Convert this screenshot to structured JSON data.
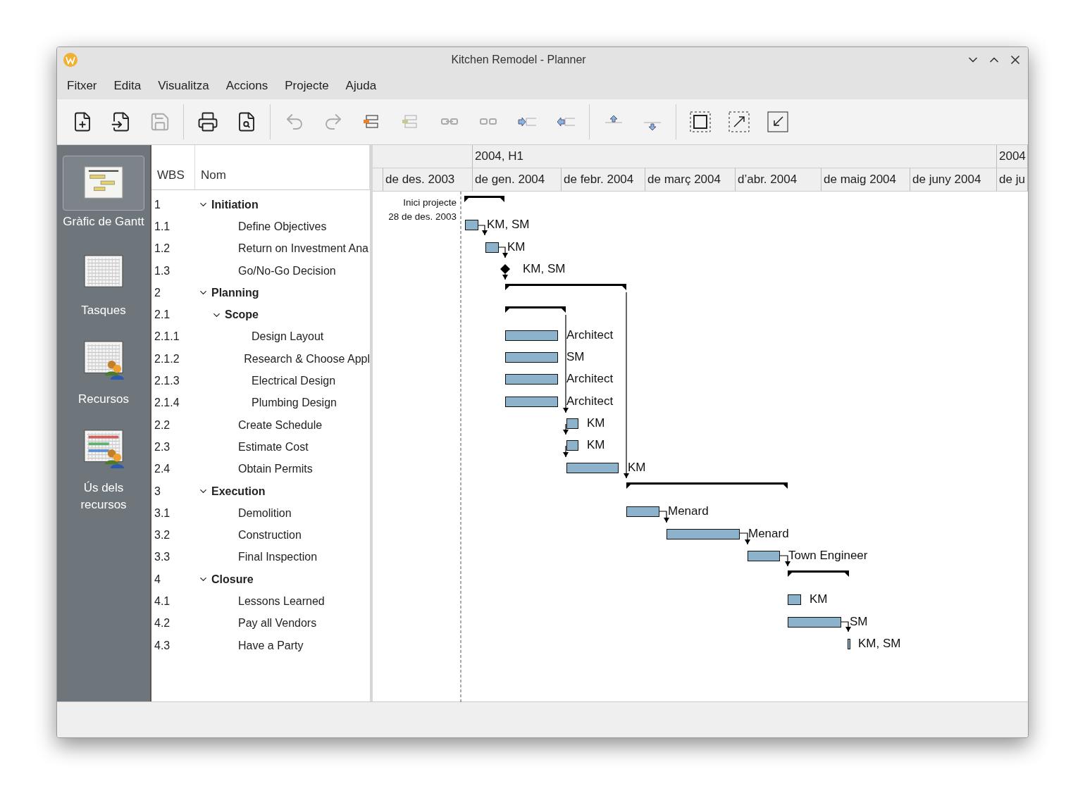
{
  "window": {
    "title": "Kitchen Remodel - Planner"
  },
  "menu": [
    "Fitxer",
    "Edita",
    "Visualitza",
    "Accions",
    "Projecte",
    "Ajuda"
  ],
  "toolbar": [
    {
      "kind": "new",
      "disabled": false
    },
    {
      "kind": "open",
      "disabled": false
    },
    {
      "kind": "save",
      "disabled": true
    },
    {
      "kind": "sep"
    },
    {
      "kind": "print",
      "disabled": false
    },
    {
      "kind": "preview",
      "disabled": false
    },
    {
      "kind": "sep"
    },
    {
      "kind": "undo",
      "disabled": true
    },
    {
      "kind": "redo",
      "disabled": true
    },
    {
      "kind": "insert",
      "disabled": false
    },
    {
      "kind": "insert2",
      "disabled": true
    },
    {
      "kind": "link",
      "disabled": true
    },
    {
      "kind": "unlink",
      "disabled": true
    },
    {
      "kind": "indent",
      "disabled": true
    },
    {
      "kind": "unindent",
      "disabled": true
    },
    {
      "kind": "sep"
    },
    {
      "kind": "up",
      "disabled": true
    },
    {
      "kind": "down",
      "disabled": true
    },
    {
      "kind": "sep"
    },
    {
      "kind": "fit",
      "disabled": false
    },
    {
      "kind": "zoomin",
      "disabled": false
    },
    {
      "kind": "zoomout",
      "disabled": false
    }
  ],
  "sidebar": {
    "items": [
      {
        "label": "Gràfic de Gantt",
        "kind": "gantt",
        "selected": true
      },
      {
        "label": "Tasques",
        "kind": "tasks",
        "selected": false
      },
      {
        "label": "Recursos",
        "kind": "resources",
        "selected": false
      },
      {
        "label": "Ús dels recursos",
        "kind": "usage",
        "selected": false
      }
    ]
  },
  "table": {
    "columns": [
      "WBS",
      "Nom"
    ],
    "rows": [
      {
        "wbs": "1",
        "name": "Initiation",
        "kind": "summary",
        "expanded": true,
        "children": [
          {
            "wbs": "1.1",
            "name": "Define Objectives",
            "kind": "task",
            "resources": "KM, SM"
          },
          {
            "wbs": "1.2",
            "name": "Return on Investment Ana",
            "kind": "task",
            "resources": "KM"
          },
          {
            "wbs": "1.3",
            "name": "Go/No-Go Decision",
            "kind": "milestone",
            "resources": "KM, SM"
          }
        ]
      },
      {
        "wbs": "2",
        "name": "Planning",
        "kind": "summary",
        "expanded": true,
        "children": [
          {
            "wbs": "2.1",
            "name": "Scope",
            "kind": "summary",
            "expanded": true,
            "children": [
              {
                "wbs": "2.1.1",
                "name": "Design Layout",
                "kind": "task",
                "resources": "Architect"
              },
              {
                "wbs": "2.1.2",
                "name": "Research & Choose Appl",
                "kind": "task",
                "resources": "SM"
              },
              {
                "wbs": "2.1.3",
                "name": "Electrical Design",
                "kind": "task",
                "resources": "Architect"
              },
              {
                "wbs": "2.1.4",
                "name": "Plumbing Design",
                "kind": "task",
                "resources": "Architect"
              }
            ]
          },
          {
            "wbs": "2.2",
            "name": "Create Schedule",
            "kind": "task",
            "resources": "KM"
          },
          {
            "wbs": "2.3",
            "name": "Estimate Cost",
            "kind": "task",
            "resources": "KM"
          },
          {
            "wbs": "2.4",
            "name": "Obtain Permits",
            "kind": "task",
            "resources": "KM"
          }
        ]
      },
      {
        "wbs": "3",
        "name": "Execution",
        "kind": "summary",
        "expanded": true,
        "children": [
          {
            "wbs": "3.1",
            "name": "Demolition",
            "kind": "task",
            "resources": "Menard"
          },
          {
            "wbs": "3.2",
            "name": "Construction",
            "kind": "task",
            "resources": "Menard"
          },
          {
            "wbs": "3.3",
            "name": "Final Inspection",
            "kind": "task",
            "resources": "Town Engineer"
          }
        ]
      },
      {
        "wbs": "4",
        "name": "Closure",
        "kind": "summary",
        "expanded": true,
        "children": [
          {
            "wbs": "4.1",
            "name": "Lessons Learned",
            "kind": "task",
            "resources": "KM"
          },
          {
            "wbs": "4.2",
            "name": "Pay all Vendors",
            "kind": "task",
            "resources": "SM"
          },
          {
            "wbs": "4.3",
            "name": "Have a Party",
            "kind": "task",
            "resources": "KM, SM"
          }
        ]
      }
    ]
  },
  "gantt": {
    "periods": [
      "2004, H1",
      "2004"
    ],
    "months": [
      "de des. 2003",
      "de gen. 2004",
      "de febr. 2004",
      "de març 2004",
      "d’abr. 2004",
      "de maig 2004",
      "de juny 2004",
      "de ju"
    ],
    "project_start": {
      "label": "Inici projecte",
      "date": "28 de des. 2003"
    }
  }
}
